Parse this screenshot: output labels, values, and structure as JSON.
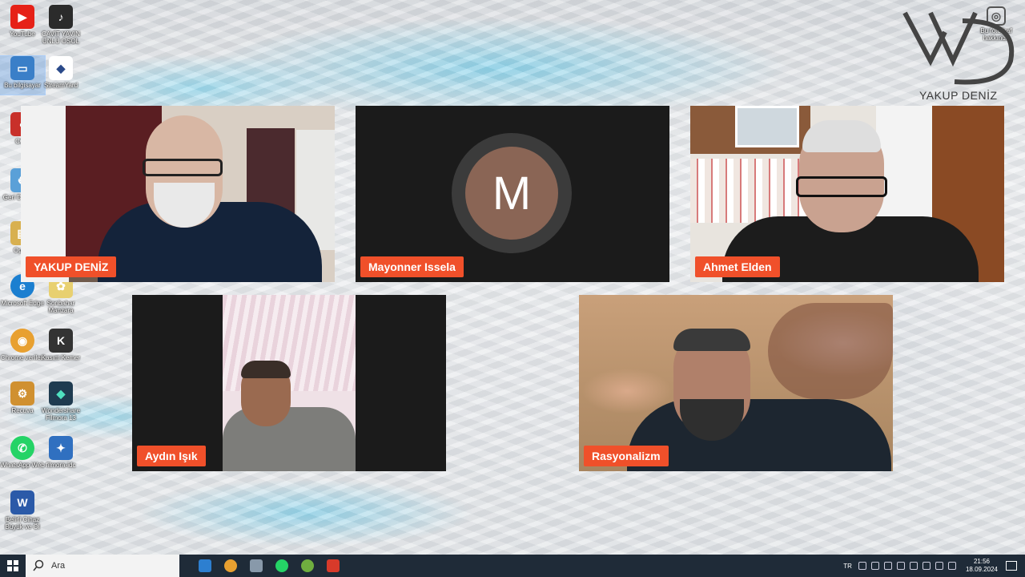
{
  "desktop": {
    "icons": [
      {
        "label": "YouTube",
        "color": "#e62117",
        "glyph": "▶"
      },
      {
        "label": "CAVİT YAVIN ÜNLÜ OSOL",
        "color": "#2b2b2b",
        "glyph": "♪"
      },
      {
        "label": "Bu bilgisayar",
        "color": "#3a7fc8",
        "glyph": "▭"
      },
      {
        "label": "StreamYard",
        "color": "#ffffff",
        "glyph": "◆"
      },
      {
        "label": "CCle",
        "color": "#c8302a",
        "glyph": "◐"
      },
      {
        "label": "Geri Dö m Ku",
        "color": "#5aa0d8",
        "glyph": "♻"
      },
      {
        "label": "Opera",
        "color": "#d8b050",
        "glyph": "▤"
      },
      {
        "label": "Microsoft Edge",
        "color": "#1b7fd0",
        "glyph": "e"
      },
      {
        "label": "Sonbahar Manzara",
        "color": "#e8d070",
        "glyph": "✿"
      },
      {
        "label": "Chrome verileri",
        "color": "#e8a030",
        "glyph": "◉"
      },
      {
        "label": "Kasım Kemer",
        "color": "#333333",
        "glyph": "K"
      },
      {
        "label": "Recuva",
        "color": "#d09030",
        "glyph": "⚙"
      },
      {
        "label": "Wondershare Filmora 13",
        "color": "#1f3b50",
        "glyph": "◆"
      },
      {
        "label": "WhatsApp Web",
        "color": "#25d366",
        "glyph": "✆"
      },
      {
        "label": "filmora-idc",
        "color": "#3070c0",
        "glyph": "✦"
      },
      {
        "label": "Belirli Cihaz Büyük ve Öl",
        "color": "#2b5aa8",
        "glyph": "W"
      }
    ],
    "right_icon_label": "Bu fotoğraf hakkında"
  },
  "brand": {
    "name": "YAKUP DENİZ"
  },
  "participants": [
    {
      "name": "YAKUP DENİZ",
      "has_video": true
    },
    {
      "name": "Mayonner Issela",
      "has_video": false,
      "initial": "M"
    },
    {
      "name": "Ahmet Elden",
      "has_video": true
    },
    {
      "name": "Aydın Işık",
      "has_video": true
    },
    {
      "name": "Rasyonalizm",
      "has_video": true
    }
  ],
  "taskbar": {
    "search_placeholder": "Ara",
    "language": "TR",
    "time": "21:56",
    "date": "18.09.2024",
    "apps": [
      {
        "name": "mail",
        "color": "#2d7fd0"
      },
      {
        "name": "chrome",
        "color": "#e8a030"
      },
      {
        "name": "camera",
        "color": "#8899aa"
      },
      {
        "name": "whatsapp",
        "color": "#25d366"
      },
      {
        "name": "krita",
        "color": "#6fae3f"
      },
      {
        "name": "vivaldi",
        "color": "#d83a2a"
      }
    ]
  }
}
